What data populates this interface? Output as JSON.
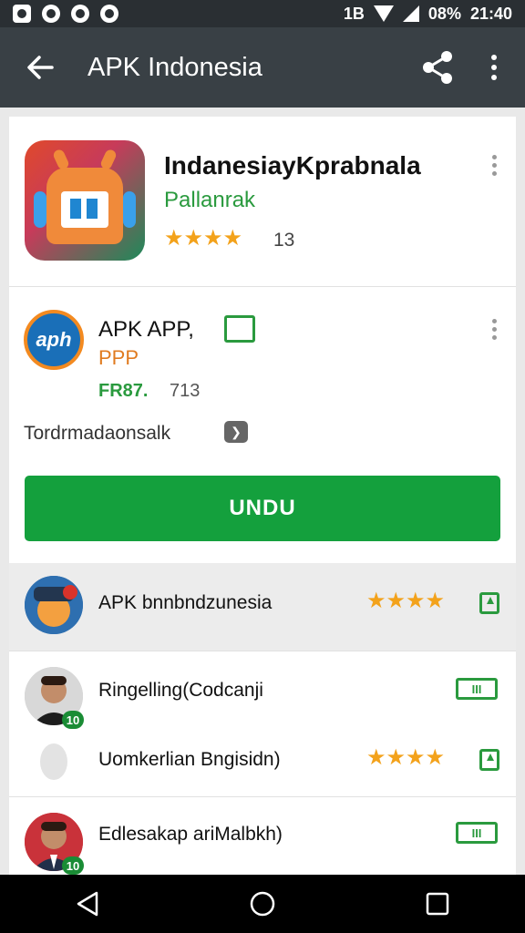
{
  "status_bar": {
    "left_icons": [
      "photo-icon",
      "sync-icon",
      "settings-icon",
      "info-icon"
    ],
    "signal_text": "1B",
    "battery_text": "08%",
    "time": "21:40"
  },
  "app_bar": {
    "title": "APK Indonesia"
  },
  "featured_app": {
    "title": "IndanesiayKprabnala",
    "developer": "Pallanrak",
    "stars": "★★★★",
    "rating_count": "13"
  },
  "secondary_app": {
    "title": "APK APP,",
    "developer": "PPP",
    "price": "FR87.",
    "count": "713",
    "description": "Tordrmadaonsalk",
    "install_label": "UNDU"
  },
  "list": [
    {
      "title": "APK bnnbndzunesia",
      "stars": "★★★★",
      "badge": ""
    },
    {
      "title": "Ringelling(Codcanji",
      "stars": "",
      "badge": "10"
    },
    {
      "title": "Uomkerlian Bngisidn)",
      "stars": "★★★★",
      "badge": ""
    },
    {
      "title": "Edlesakap ariMalbkh)",
      "stars": "",
      "badge": "10"
    }
  ],
  "colors": {
    "app_bar": "#394045",
    "accent_green": "#14a03d",
    "star_orange": "#f3a21b"
  }
}
